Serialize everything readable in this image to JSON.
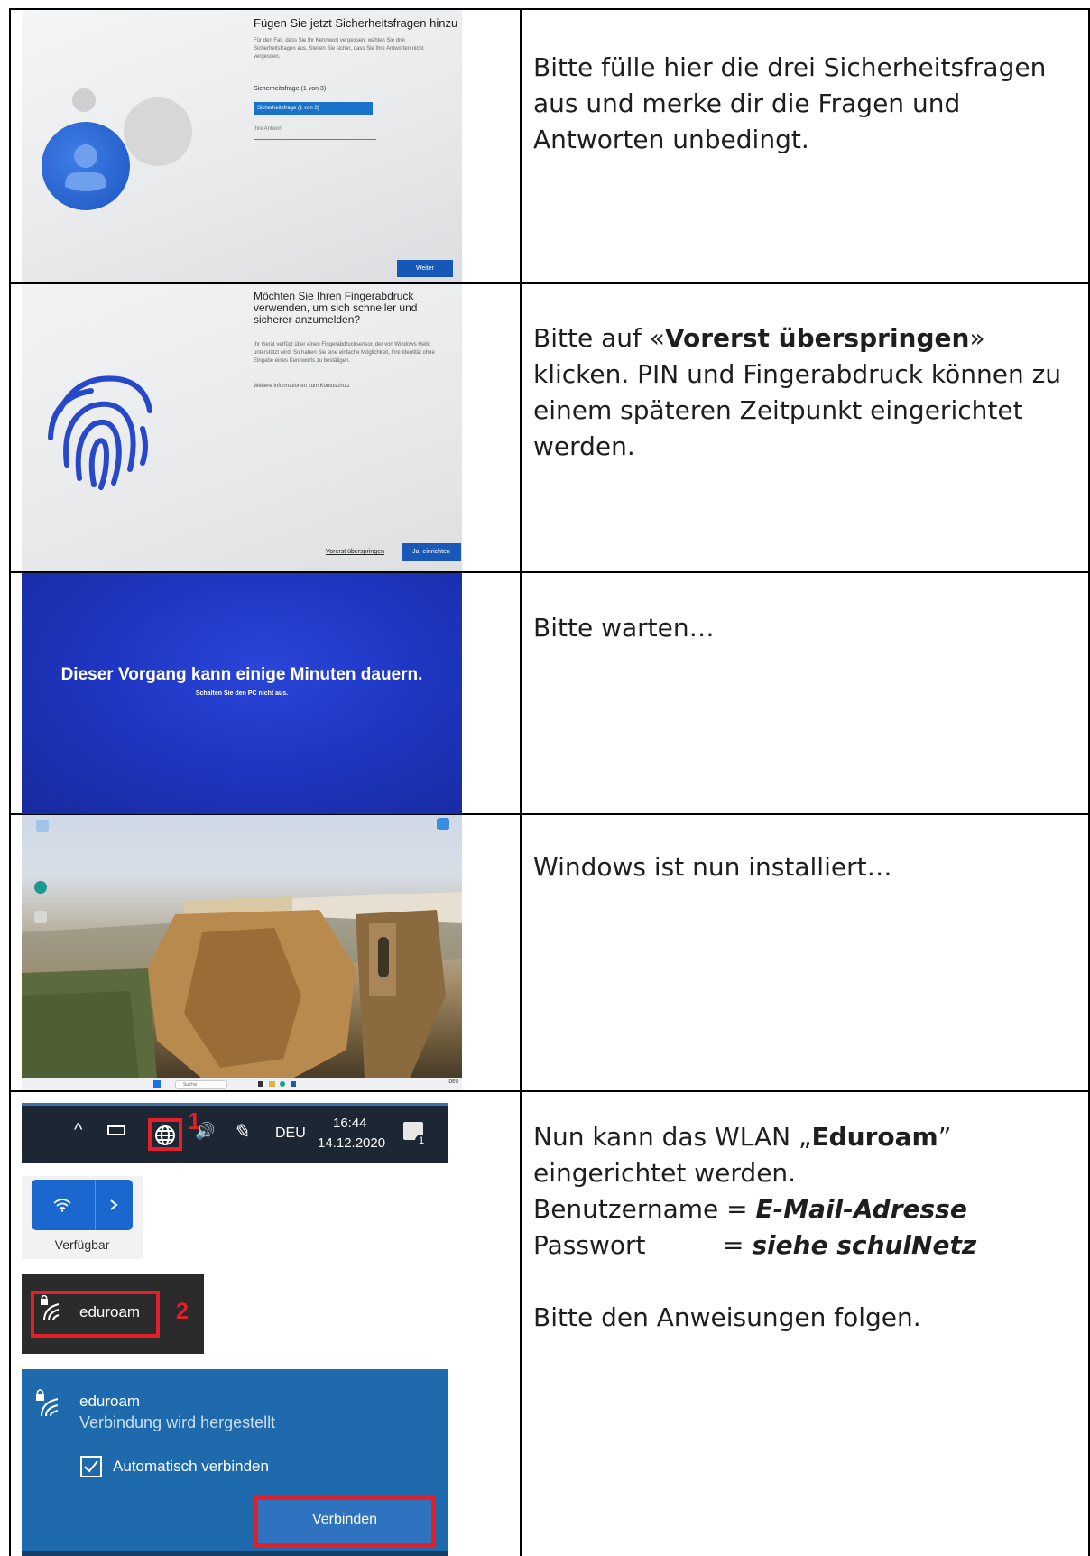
{
  "rows": [
    {
      "instruction": "Bitte fülle hier die drei Sicherheitsfragen aus und merke dir die Fragen und Antworten unbedingt.",
      "screen": {
        "title": "Fügen Sie jetzt Sicherheitsfragen hinzu",
        "body": "Für den Fall, dass Sie Ihr Kennwort vergessen, wählen Sie drei Sicherheitsfragen aus. Stellen Sie sicher, dass Sie Ihre Antworten nicht vergessen.",
        "field_label": "Sicherheitsfrage (1 von 3)",
        "select_value": "Sicherheitsfrage (1 von 3)",
        "answer_placeholder": "Ihre Antwort",
        "button": "Weiter"
      }
    },
    {
      "instruction_prefix": "Bitte auf «",
      "instruction_bold": "Vorerst überspringen",
      "instruction_suffix": "» klicken. PIN und Fingerabdruck können zu einem späteren Zeitpunkt eingerichtet werden.",
      "screen": {
        "title": "Möchten Sie Ihren Fingerabdruck verwenden, um sich schneller und sicherer anzumelden?",
        "body": "Ihr Gerät verfügt über einen Fingerabdrucksensor, der von Windows Hello unterstützt wird. So haben Sie eine einfache Möglichkeit, Ihre Identität ohne Eingabe eines Kennworts zu bestätigen.",
        "link": "Weitere Informationen zum Kontoschutz",
        "skip": "Vorerst überspringen",
        "button": "Ja, einrichten"
      }
    },
    {
      "instruction": "Bitte warten…",
      "screen": {
        "headline": "Dieser Vorgang kann einige Minuten dauern.",
        "subline": "Schalten Sie den PC nicht aus."
      }
    },
    {
      "instruction": "Windows ist nun installiert…",
      "screen": {
        "search": "Suche",
        "tray_lang": "DEU"
      }
    },
    {
      "instruction_line1_prefix": "Nun kann das WLAN „",
      "instruction_line1_bold": "Eduroam",
      "instruction_line1_suffix": "”",
      "instruction_line2": "eingerichtet werden.",
      "user_label": "Benutzername = ",
      "user_value": "E-Mail-Adresse",
      "pass_label": "Passwort",
      "pass_eq": "= ",
      "pass_value": "siehe schulNetz",
      "follow": "Bitte den Anweisungen folgen.",
      "tray": {
        "lang": "DEU",
        "time": "16:44",
        "date": "14.12.2020",
        "marker": "1",
        "notif_count": "1"
      },
      "wifi_tile_label": "Verfügbar",
      "network_name": "eduroam",
      "marker2": "2",
      "panel": {
        "network": "eduroam",
        "status": "Verbindung wird hergestellt",
        "auto_connect": "Automatisch verbinden",
        "connect_button": "Verbinden"
      }
    }
  ]
}
